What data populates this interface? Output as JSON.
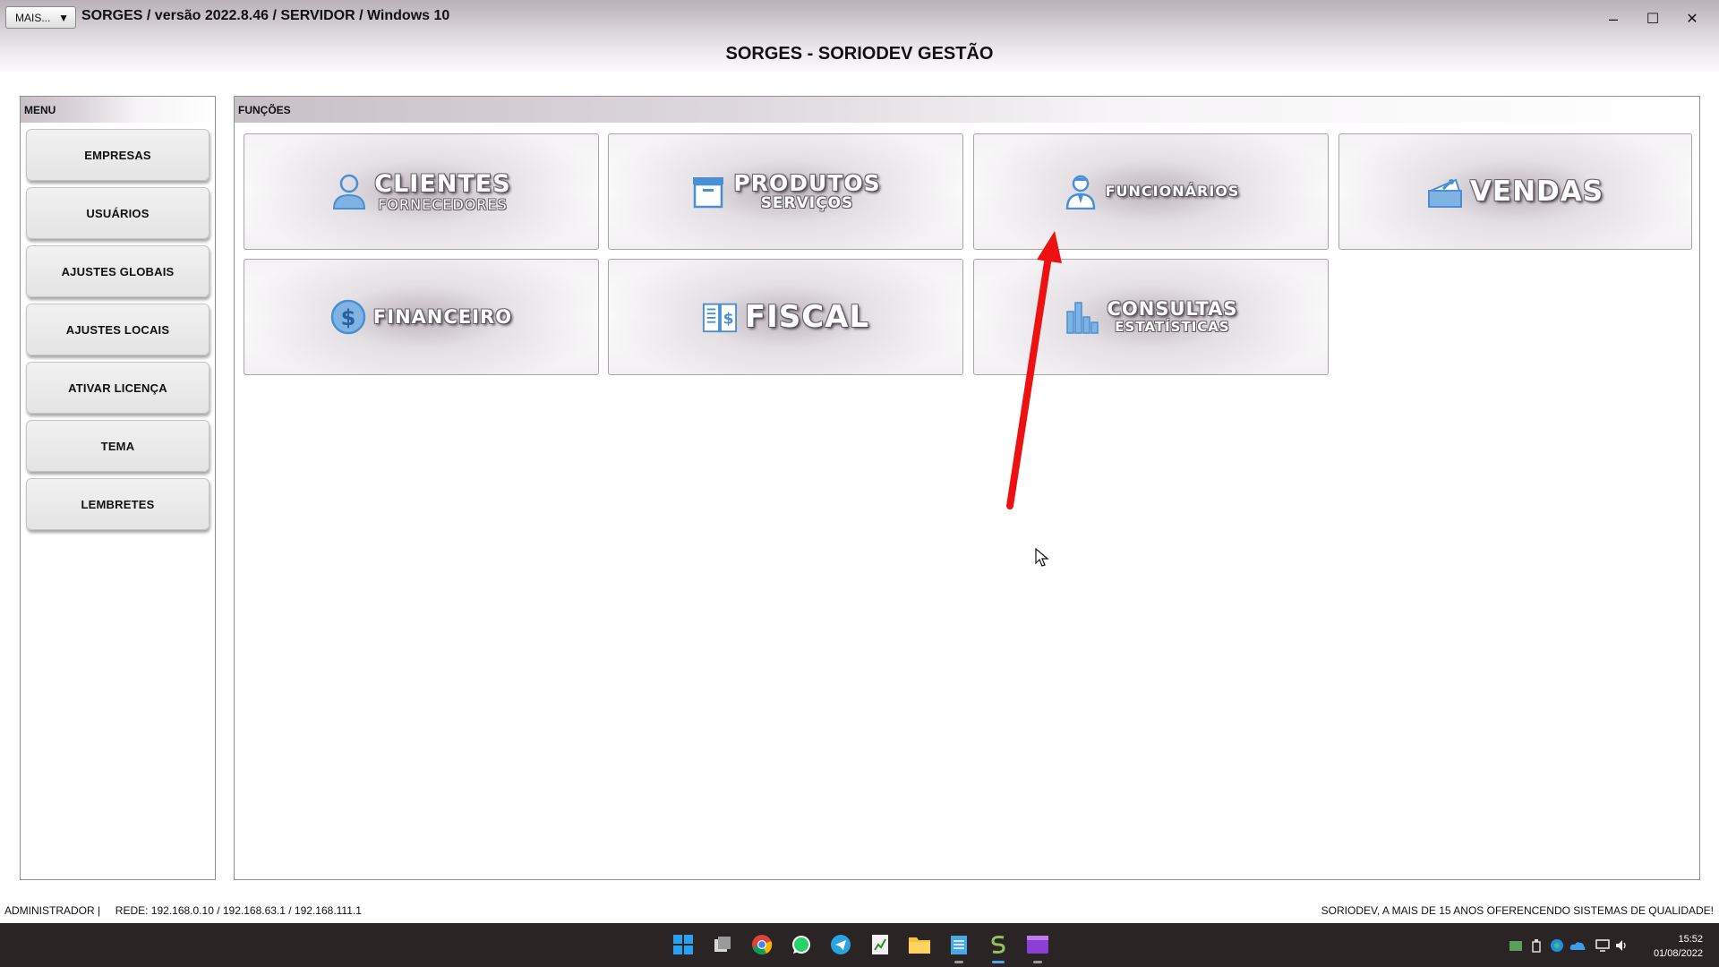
{
  "window": {
    "more_button": "MAIS...",
    "title": "SORGES / versão 2022.8.46 / SERVIDOR / Windows 10",
    "minimize": "–",
    "maximize": "☐",
    "close": "✕"
  },
  "app": {
    "heading": "SORGES - SORIODEV GESTÃO"
  },
  "menu": {
    "header": "MENU",
    "items": [
      {
        "label": "EMPRESAS"
      },
      {
        "label": "USUÁRIOS"
      },
      {
        "label": "AJUSTES GLOBAIS"
      },
      {
        "label": "AJUSTES LOCAIS"
      },
      {
        "label": "ATIVAR LICENÇA"
      },
      {
        "label": "TEMA"
      },
      {
        "label": "LEMBRETES"
      }
    ]
  },
  "functions": {
    "header": "FUNÇÕES",
    "tiles": [
      {
        "main": "CLIENTES",
        "sub": "FORNECEDORES",
        "icon": "person-icon"
      },
      {
        "main": "PRODUTOS",
        "sub": "SERVIÇOS",
        "icon": "box-icon"
      },
      {
        "main": "FUNCIONÁRIOS",
        "icon": "employee-icon"
      },
      {
        "main": "VENDAS",
        "icon": "cash-register-icon"
      },
      {
        "main": "FINANCEIRO",
        "icon": "dollar-coin-icon"
      },
      {
        "main": "FISCAL",
        "icon": "ledger-icon"
      },
      {
        "main": "CONSULTAS",
        "sub": "ESTATÍSTICAS",
        "icon": "bar-chart-icon"
      }
    ]
  },
  "status": {
    "left": "ADMINISTRADOR |     REDE: 192.168.0.10 / 192.168.63.1 / 192.168.111.1",
    "right": "SORIODEV, A MAIS DE 15 ANOS OFERENCENDO SISTEMAS DE QUALIDADE!"
  },
  "taskbar": {
    "time": "15:52",
    "date": "01/08/2022",
    "apps": [
      "start-icon",
      "task-view-icon",
      "chrome-icon",
      "whatsapp-icon",
      "telegram-icon",
      "spreadsheet-icon",
      "file-explorer-icon",
      "notepad-icon",
      "sorges-icon",
      "video-editor-icon"
    ]
  },
  "colors": {
    "icon_blue": "#4a8fd4",
    "annotation_red": "#ee1111"
  }
}
